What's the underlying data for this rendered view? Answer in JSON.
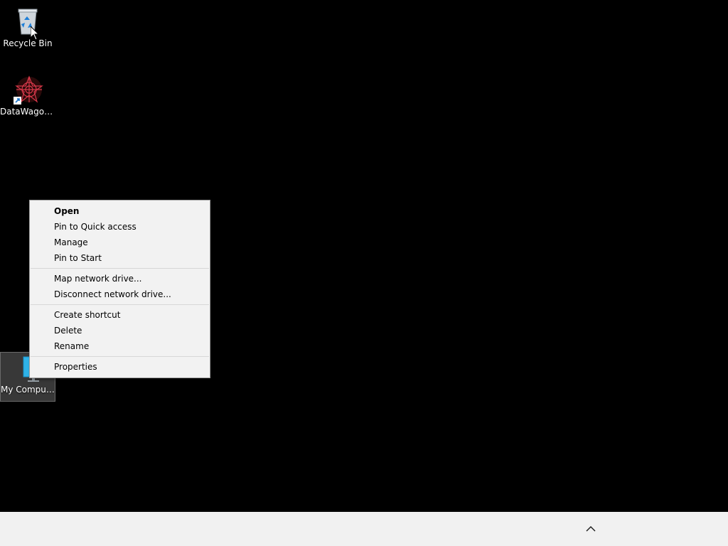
{
  "desktop": {
    "icons": [
      {
        "label": "Recycle Bin",
        "icon": "recycle-bin-icon"
      },
      {
        "label": "DataWagon...",
        "icon": "datawagon-shortcut-icon"
      },
      {
        "label": "My Computer",
        "icon": "monitor-icon",
        "selected": true
      }
    ]
  },
  "context_menu": {
    "groups": [
      [
        {
          "label": "Open",
          "default": true
        },
        {
          "label": "Pin to Quick access"
        },
        {
          "label": "Manage"
        },
        {
          "label": "Pin to Start"
        }
      ],
      [
        {
          "label": "Map network drive..."
        },
        {
          "label": "Disconnect network drive..."
        }
      ],
      [
        {
          "label": "Create shortcut"
        },
        {
          "label": "Delete"
        },
        {
          "label": "Rename"
        }
      ],
      [
        {
          "label": "Properties"
        }
      ]
    ]
  },
  "taskbar": {
    "tray_icon": "chevron-up-icon"
  },
  "colors": {
    "desktop_background": "#000000",
    "taskbar_background": "#f1f1f1",
    "menu_background": "#f2f2f2"
  }
}
